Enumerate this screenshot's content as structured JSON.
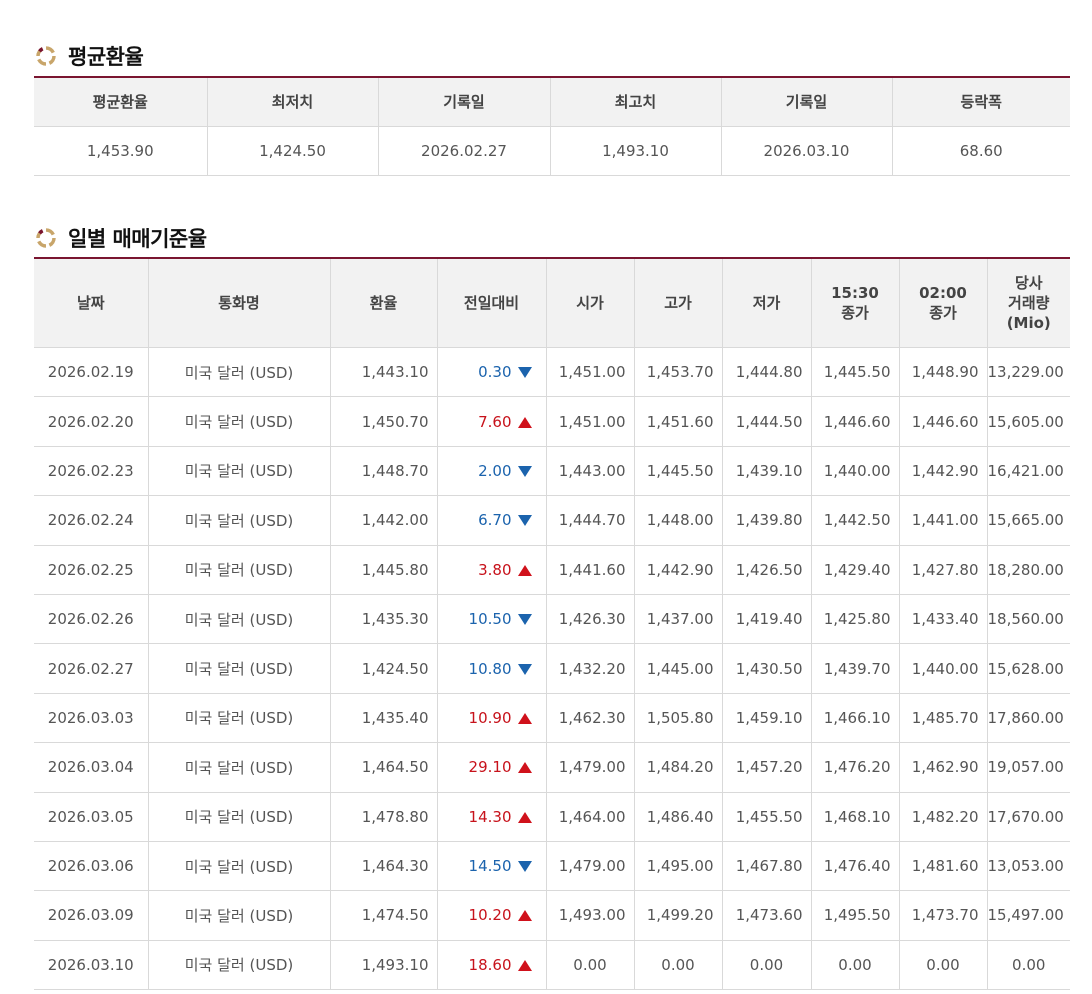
{
  "avg_section": {
    "title": "평균환율",
    "headers": [
      "평균환율",
      "최저치",
      "기록일",
      "최고치",
      "기록일",
      "등락폭"
    ],
    "values": [
      "1,453.90",
      "1,424.50",
      "2026.02.27",
      "1,493.10",
      "2026.03.10",
      "68.60"
    ]
  },
  "daily_section": {
    "title": "일별 매매기준율",
    "headers": {
      "date": "날짜",
      "currency": "통화명",
      "rate": "환율",
      "change": "전일대비",
      "open": "시가",
      "high": "고가",
      "low": "저가",
      "close1530_a": "15:30",
      "close1530_b": "종가",
      "close0200_a": "02:00",
      "close0200_b": "종가",
      "volume_a": "당사",
      "volume_b": "거래량",
      "volume_c": "(Mio)"
    },
    "rows": [
      {
        "date": "2026.02.19",
        "currency": "미국 달러 (USD)",
        "rate": "1,443.10",
        "change": "0.30",
        "dir": "down",
        "open": "1,451.00",
        "high": "1,453.70",
        "low": "1,444.80",
        "close1530": "1,445.50",
        "close0200": "1,448.90",
        "volume": "13,229.00"
      },
      {
        "date": "2026.02.20",
        "currency": "미국 달러 (USD)",
        "rate": "1,450.70",
        "change": "7.60",
        "dir": "up",
        "open": "1,451.00",
        "high": "1,451.60",
        "low": "1,444.50",
        "close1530": "1,446.60",
        "close0200": "1,446.60",
        "volume": "15,605.00"
      },
      {
        "date": "2026.02.23",
        "currency": "미국 달러 (USD)",
        "rate": "1,448.70",
        "change": "2.00",
        "dir": "down",
        "open": "1,443.00",
        "high": "1,445.50",
        "low": "1,439.10",
        "close1530": "1,440.00",
        "close0200": "1,442.90",
        "volume": "16,421.00"
      },
      {
        "date": "2026.02.24",
        "currency": "미국 달러 (USD)",
        "rate": "1,442.00",
        "change": "6.70",
        "dir": "down",
        "open": "1,444.70",
        "high": "1,448.00",
        "low": "1,439.80",
        "close1530": "1,442.50",
        "close0200": "1,441.00",
        "volume": "15,665.00"
      },
      {
        "date": "2026.02.25",
        "currency": "미국 달러 (USD)",
        "rate": "1,445.80",
        "change": "3.80",
        "dir": "up",
        "open": "1,441.60",
        "high": "1,442.90",
        "low": "1,426.50",
        "close1530": "1,429.40",
        "close0200": "1,427.80",
        "volume": "18,280.00"
      },
      {
        "date": "2026.02.26",
        "currency": "미국 달러 (USD)",
        "rate": "1,435.30",
        "change": "10.50",
        "dir": "down",
        "open": "1,426.30",
        "high": "1,437.00",
        "low": "1,419.40",
        "close1530": "1,425.80",
        "close0200": "1,433.40",
        "volume": "18,560.00"
      },
      {
        "date": "2026.02.27",
        "currency": "미국 달러 (USD)",
        "rate": "1,424.50",
        "change": "10.80",
        "dir": "down",
        "open": "1,432.20",
        "high": "1,445.00",
        "low": "1,430.50",
        "close1530": "1,439.70",
        "close0200": "1,440.00",
        "volume": "15,628.00"
      },
      {
        "date": "2026.03.03",
        "currency": "미국 달러 (USD)",
        "rate": "1,435.40",
        "change": "10.90",
        "dir": "up",
        "open": "1,462.30",
        "high": "1,505.80",
        "low": "1,459.10",
        "close1530": "1,466.10",
        "close0200": "1,485.70",
        "volume": "17,860.00"
      },
      {
        "date": "2026.03.04",
        "currency": "미국 달러 (USD)",
        "rate": "1,464.50",
        "change": "29.10",
        "dir": "up",
        "open": "1,479.00",
        "high": "1,484.20",
        "low": "1,457.20",
        "close1530": "1,476.20",
        "close0200": "1,462.90",
        "volume": "19,057.00"
      },
      {
        "date": "2026.03.05",
        "currency": "미국 달러 (USD)",
        "rate": "1,478.80",
        "change": "14.30",
        "dir": "up",
        "open": "1,464.00",
        "high": "1,486.40",
        "low": "1,455.50",
        "close1530": "1,468.10",
        "close0200": "1,482.20",
        "volume": "17,670.00"
      },
      {
        "date": "2026.03.06",
        "currency": "미국 달러 (USD)",
        "rate": "1,464.30",
        "change": "14.50",
        "dir": "down",
        "open": "1,479.00",
        "high": "1,495.00",
        "low": "1,467.80",
        "close1530": "1,476.40",
        "close0200": "1,481.60",
        "volume": "13,053.00"
      },
      {
        "date": "2026.03.09",
        "currency": "미국 달러 (USD)",
        "rate": "1,474.50",
        "change": "10.20",
        "dir": "up",
        "open": "1,493.00",
        "high": "1,499.20",
        "low": "1,473.60",
        "close1530": "1,495.50",
        "close0200": "1,473.70",
        "volume": "15,497.00"
      },
      {
        "date": "2026.03.10",
        "currency": "미국 달러 (USD)",
        "rate": "1,493.10",
        "change": "18.60",
        "dir": "up",
        "open": "0.00",
        "high": "0.00",
        "low": "0.00",
        "close1530": "0.00",
        "close0200": "0.00",
        "volume": "0.00"
      }
    ]
  },
  "colors": {
    "accent_border": "#7a1530",
    "down": "#1b63ad",
    "up": "#c7121b",
    "header_bg": "#f2f2f2"
  },
  "icons": {
    "section_icon": "ring-bullet-icon",
    "down": "triangle-down-icon",
    "up": "triangle-up-icon"
  }
}
